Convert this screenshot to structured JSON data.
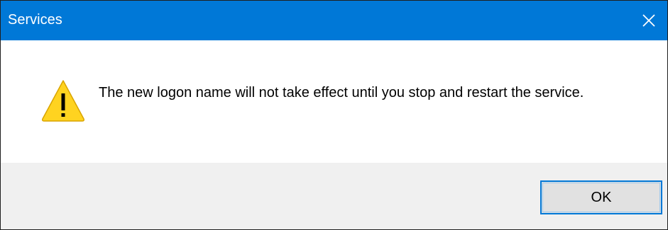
{
  "window": {
    "title": "Services"
  },
  "message": {
    "text": "The new logon name will not take effect until you stop and restart the service.",
    "icon": "warning-icon"
  },
  "buttons": {
    "ok_label": "OK"
  },
  "colors": {
    "titlebar": "#0078d7",
    "warning_fill": "#ffcc00",
    "button_border": "#0078d7"
  }
}
